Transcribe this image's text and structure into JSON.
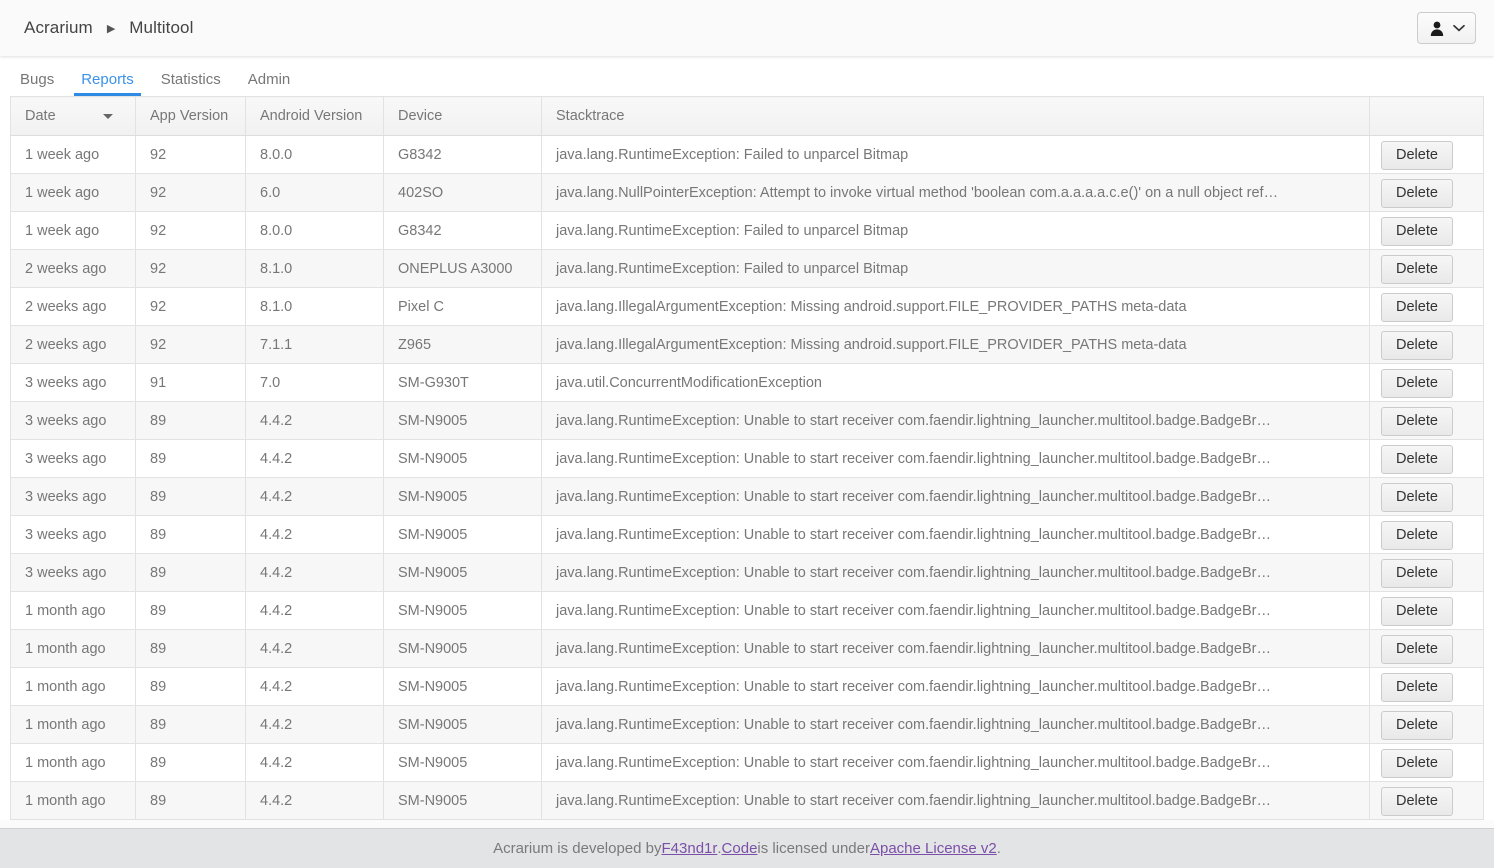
{
  "topbar": {
    "breadcrumb": [
      "Acrarium",
      "Multitool"
    ],
    "separator": "▶",
    "user_menu": {
      "icon": "user-icon",
      "chevron": "chevron-down-icon"
    }
  },
  "tabs": [
    {
      "label": "Bugs",
      "active": false
    },
    {
      "label": "Reports",
      "active": true
    },
    {
      "label": "Statistics",
      "active": false
    },
    {
      "label": "Admin",
      "active": false
    }
  ],
  "table": {
    "columns": [
      {
        "label": "Date",
        "key": "date",
        "sorted": "desc"
      },
      {
        "label": "App Version",
        "key": "app_version"
      },
      {
        "label": "Android Version",
        "key": "android_version"
      },
      {
        "label": "Device",
        "key": "device"
      },
      {
        "label": "Stacktrace",
        "key": "stacktrace"
      },
      {
        "label": "",
        "key": "actions"
      }
    ],
    "action_label": "Delete",
    "rows": [
      {
        "date": "1 week ago",
        "app_version": "92",
        "android_version": "8.0.0",
        "device": "G8342",
        "stacktrace": "java.lang.RuntimeException: Failed to unparcel Bitmap"
      },
      {
        "date": "1 week ago",
        "app_version": "92",
        "android_version": "6.0",
        "device": "402SO",
        "stacktrace": "java.lang.NullPointerException: Attempt to invoke virtual method 'boolean com.a.a.a.a.c.e()' on a null object ref…"
      },
      {
        "date": "1 week ago",
        "app_version": "92",
        "android_version": "8.0.0",
        "device": "G8342",
        "stacktrace": "java.lang.RuntimeException: Failed to unparcel Bitmap"
      },
      {
        "date": "2 weeks ago",
        "app_version": "92",
        "android_version": "8.1.0",
        "device": "ONEPLUS A3000",
        "stacktrace": "java.lang.RuntimeException: Failed to unparcel Bitmap"
      },
      {
        "date": "2 weeks ago",
        "app_version": "92",
        "android_version": "8.1.0",
        "device": "Pixel C",
        "stacktrace": "java.lang.IllegalArgumentException: Missing android.support.FILE_PROVIDER_PATHS meta-data"
      },
      {
        "date": "2 weeks ago",
        "app_version": "92",
        "android_version": "7.1.1",
        "device": "Z965",
        "stacktrace": "java.lang.IllegalArgumentException: Missing android.support.FILE_PROVIDER_PATHS meta-data"
      },
      {
        "date": "3 weeks ago",
        "app_version": "91",
        "android_version": "7.0",
        "device": "SM-G930T",
        "stacktrace": "java.util.ConcurrentModificationException"
      },
      {
        "date": "3 weeks ago",
        "app_version": "89",
        "android_version": "4.4.2",
        "device": "SM-N9005",
        "stacktrace": "java.lang.RuntimeException: Unable to start receiver com.faendir.lightning_launcher.multitool.badge.BadgeBr…"
      },
      {
        "date": "3 weeks ago",
        "app_version": "89",
        "android_version": "4.4.2",
        "device": "SM-N9005",
        "stacktrace": "java.lang.RuntimeException: Unable to start receiver com.faendir.lightning_launcher.multitool.badge.BadgeBr…"
      },
      {
        "date": "3 weeks ago",
        "app_version": "89",
        "android_version": "4.4.2",
        "device": "SM-N9005",
        "stacktrace": "java.lang.RuntimeException: Unable to start receiver com.faendir.lightning_launcher.multitool.badge.BadgeBr…"
      },
      {
        "date": "3 weeks ago",
        "app_version": "89",
        "android_version": "4.4.2",
        "device": "SM-N9005",
        "stacktrace": "java.lang.RuntimeException: Unable to start receiver com.faendir.lightning_launcher.multitool.badge.BadgeBr…"
      },
      {
        "date": "3 weeks ago",
        "app_version": "89",
        "android_version": "4.4.2",
        "device": "SM-N9005",
        "stacktrace": "java.lang.RuntimeException: Unable to start receiver com.faendir.lightning_launcher.multitool.badge.BadgeBr…"
      },
      {
        "date": "1 month ago",
        "app_version": "89",
        "android_version": "4.4.2",
        "device": "SM-N9005",
        "stacktrace": "java.lang.RuntimeException: Unable to start receiver com.faendir.lightning_launcher.multitool.badge.BadgeBr…"
      },
      {
        "date": "1 month ago",
        "app_version": "89",
        "android_version": "4.4.2",
        "device": "SM-N9005",
        "stacktrace": "java.lang.RuntimeException: Unable to start receiver com.faendir.lightning_launcher.multitool.badge.BadgeBr…"
      },
      {
        "date": "1 month ago",
        "app_version": "89",
        "android_version": "4.4.2",
        "device": "SM-N9005",
        "stacktrace": "java.lang.RuntimeException: Unable to start receiver com.faendir.lightning_launcher.multitool.badge.BadgeBr…"
      },
      {
        "date": "1 month ago",
        "app_version": "89",
        "android_version": "4.4.2",
        "device": "SM-N9005",
        "stacktrace": "java.lang.RuntimeException: Unable to start receiver com.faendir.lightning_launcher.multitool.badge.BadgeBr…"
      },
      {
        "date": "1 month ago",
        "app_version": "89",
        "android_version": "4.4.2",
        "device": "SM-N9005",
        "stacktrace": "java.lang.RuntimeException: Unable to start receiver com.faendir.lightning_launcher.multitool.badge.BadgeBr…"
      },
      {
        "date": "1 month ago",
        "app_version": "89",
        "android_version": "4.4.2",
        "device": "SM-N9005",
        "stacktrace": "java.lang.RuntimeException: Unable to start receiver com.faendir.lightning_launcher.multitool.badge.BadgeBr…"
      }
    ]
  },
  "footer": {
    "text_1": "Acrarium is developed by ",
    "link_author": "F43nd1r",
    "text_2": ". ",
    "link_code": "Code",
    "text_3": " is licensed under ",
    "link_license": "Apache License v2",
    "text_4": "."
  },
  "colors": {
    "accent": "#2f8ae4",
    "tab_active_text": "#3b93e8",
    "footer_link": "#7b4fa8",
    "row_alt": "#f7f7f7",
    "footer_bg": "#e3e4e6"
  }
}
